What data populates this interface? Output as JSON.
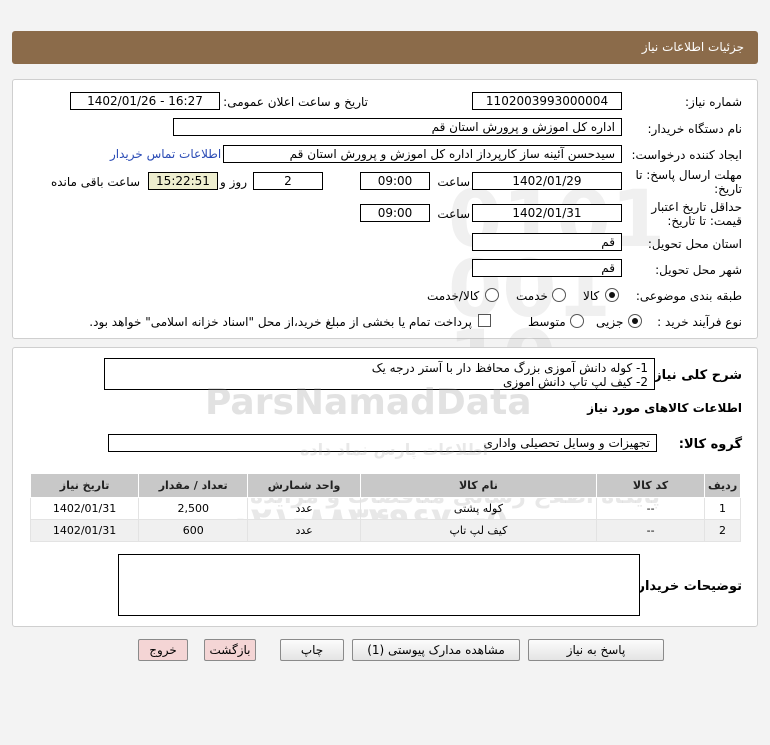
{
  "header": {
    "title": "جزئیات اطلاعات نیاز"
  },
  "form": {
    "need_number_label": "شماره نیاز:",
    "need_number": "1102003993000004",
    "announce_label": "تاریخ و ساعت اعلان عمومی:",
    "announce_value": "1402/01/26 - 16:27",
    "buyer_org_label": "نام دستگاه خریدار:",
    "buyer_org": "اداره کل اموزش و پرورش استان قم",
    "creator_label": "ایجاد کننده درخواست:",
    "creator": "سیدحسن آئینه ساز کارپرداز اداره کل اموزش و پرورش استان قم",
    "contact_link": "اطلاعات تماس خریدار",
    "deadline_label_1": "مهلت ارسال پاسخ: تا",
    "deadline_label_2": "تاریخ:",
    "deadline_date": "1402/01/29",
    "hour_label": "ساعت",
    "deadline_time": "09:00",
    "days_value": "2",
    "days_label": "روز و",
    "remaining_time": "15:22:51",
    "remaining_label": "ساعت باقی مانده",
    "validity_label_1": "حداقل تاریخ اعتبار",
    "validity_label_2": "قیمت: تا تاریخ:",
    "validity_date": "1402/01/31",
    "validity_hour_label": "ساعت",
    "validity_time": "09:00",
    "province_label": "استان محل تحویل:",
    "province": "قم",
    "city_label": "شهر محل تحویل:",
    "city": "قم",
    "category_label": "طبقه بندی موضوعی:",
    "category_options": [
      "کالا",
      "خدمت",
      "کالا/خدمت"
    ],
    "process_label": "نوع فرآیند خرید :",
    "process_options": [
      "جزیی",
      "متوسط"
    ],
    "payment_note": "پرداخت تمام یا بخشی از مبلغ خرید،از محل \"اسناد خزانه اسلامی\" خواهد بود."
  },
  "summary": {
    "label": "شرح کلی نیاز:",
    "line1": "1- کوله دانش آموزی بزرگ محافظ دار با آستر درجه یک",
    "line2": "2- کیف لپ تاپ دانش اموزی",
    "goods_info_title": "اطلاعات کالاهای مورد نیاز",
    "group_label": "گروه کالا:",
    "group_value": "تجهیزات و وسایل تحصیلی واداری"
  },
  "table": {
    "headers": [
      "ردیف",
      "کد کالا",
      "نام کالا",
      "واحد شمارش",
      "تعداد / مقدار",
      "تاریخ نیاز"
    ],
    "rows": [
      [
        "1",
        "--",
        "کوله پشتی",
        "عدد",
        "2,500",
        "1402/01/31"
      ],
      [
        "2",
        "--",
        "کیف لپ تاپ",
        "عدد",
        "600",
        "1402/01/31"
      ]
    ]
  },
  "notes": {
    "label": "توضیحات خریدار:",
    "value": ""
  },
  "buttons": {
    "reply": "پاسخ به نیاز",
    "view_docs": "مشاهده مدارک پیوستی (1)",
    "print": "چاپ",
    "back": "بازگشت",
    "exit": "خروج"
  },
  "watermark": {
    "brand": "ParsNamadData",
    "line1": "پایگاه اطلاع رسانی مناقصات و مزایده",
    "line2": "اطلاعات پارس نماد داده",
    "phone": "۰۲۱-۸۸۳۴۹۶۷۰-۵"
  },
  "colors": {
    "header_bg": "#8b6b4a",
    "link": "#2a4bb5",
    "table_header": "#c8c8c8",
    "remaining_bg": "#eeeecf"
  }
}
